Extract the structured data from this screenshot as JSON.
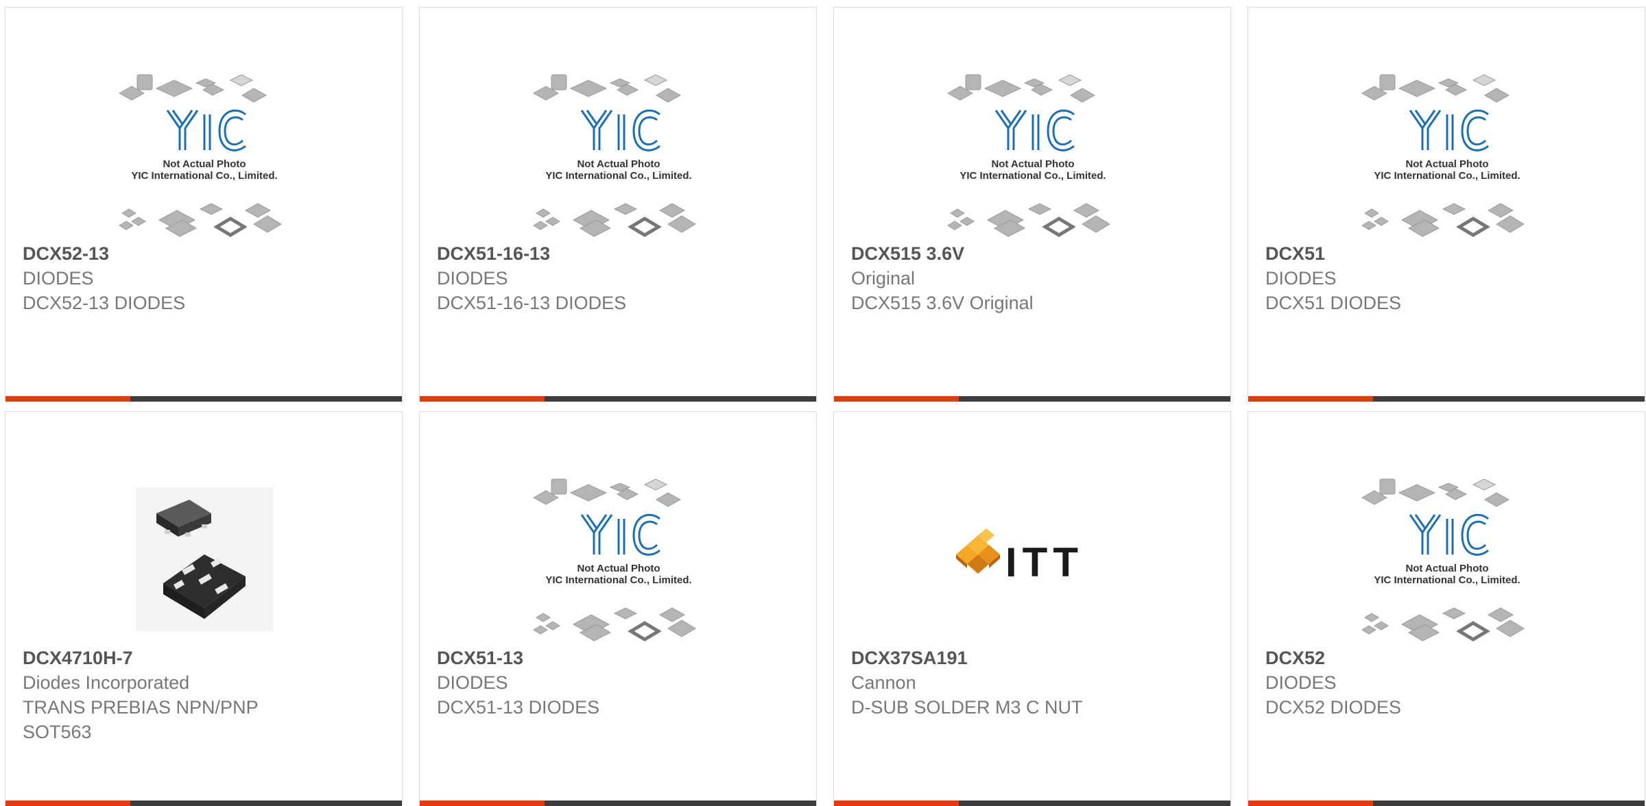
{
  "products": [
    {
      "part_number": "DCX52-13",
      "manufacturer": "DIODES",
      "description": "DCX52-13 DIODES",
      "image": "not-actual-photo",
      "extra": ""
    },
    {
      "part_number": "DCX51-16-13",
      "manufacturer": "DIODES",
      "description": "DCX51-16-13 DIODES",
      "image": "not-actual-photo",
      "extra": ""
    },
    {
      "part_number": "DCX515 3.6V",
      "manufacturer": "Original",
      "description": "DCX515 3.6V Original",
      "image": "not-actual-photo",
      "extra": ""
    },
    {
      "part_number": "DCX51",
      "manufacturer": "DIODES",
      "description": "DCX51 DIODES",
      "image": "not-actual-photo",
      "extra": ""
    },
    {
      "part_number": "DCX4710H-7",
      "manufacturer": "Diodes Incorporated",
      "description": "TRANS PREBIAS NPN/PNP",
      "image": "sot563-package-photo",
      "extra": "SOT563"
    },
    {
      "part_number": "DCX51-13",
      "manufacturer": "DIODES",
      "description": "DCX51-13 DIODES",
      "image": "not-actual-photo",
      "extra": ""
    },
    {
      "part_number": "DCX37SA191",
      "manufacturer": "Cannon",
      "description": "D-SUB SOLDER M3 C NUT",
      "image": "itt-logo",
      "extra": ""
    },
    {
      "part_number": "DCX52",
      "manufacturer": "DIODES",
      "description": "DCX52 DIODES",
      "image": "not-actual-photo",
      "extra": ""
    }
  ],
  "placeholder": {
    "brand": "YIC",
    "line1": "Not Actual Photo",
    "line2": "YIC International Co., Limited."
  },
  "itt_logo_text": "ITT",
  "colors": {
    "accent_bar": "#e63a10",
    "dark_bar": "#3d3d3d",
    "yic_blue": "#1a6fb5",
    "itt_orange": "#f5a623"
  }
}
